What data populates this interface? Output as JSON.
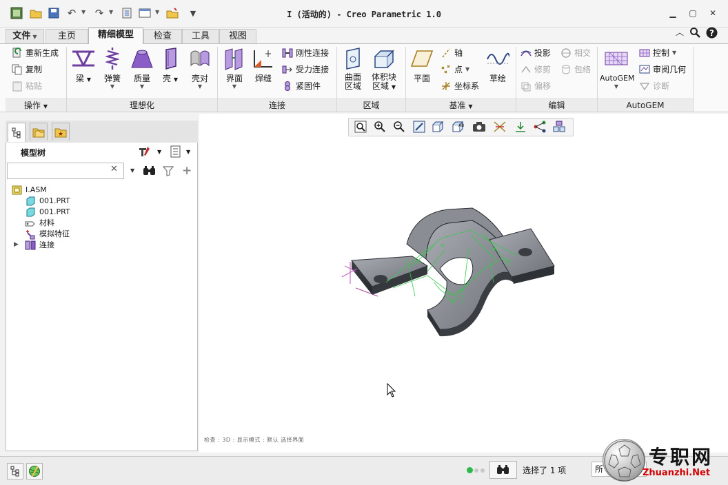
{
  "window": {
    "title": "I (活动的) - Creo Parametric 1.0"
  },
  "tabs": [
    {
      "label": "文件",
      "has_dropdown": true
    },
    {
      "label": "主页"
    },
    {
      "label": "精细模型",
      "active": true
    },
    {
      "label": "检查"
    },
    {
      "label": "工具"
    },
    {
      "label": "视图"
    }
  ],
  "ribbon": {
    "operations": {
      "label": "操作",
      "items": [
        {
          "label": "重新生成",
          "enabled": true
        },
        {
          "label": "复制",
          "enabled": true
        },
        {
          "label": "粘贴",
          "enabled": false
        }
      ]
    },
    "idealization": {
      "label": "理想化",
      "items": [
        {
          "label": "梁"
        },
        {
          "label": "弹簧"
        },
        {
          "label": "质量"
        },
        {
          "label": "壳"
        },
        {
          "label": "壳对"
        }
      ]
    },
    "connections": {
      "label": "连接",
      "big": [
        {
          "label": "界面"
        },
        {
          "label": "焊缝"
        }
      ],
      "small": [
        {
          "label": "刚性连接"
        },
        {
          "label": "受力连接"
        },
        {
          "label": "紧固件"
        }
      ]
    },
    "regions": {
      "label": "区域",
      "items": [
        {
          "label_line1": "曲面",
          "label_line2": "区域"
        },
        {
          "label_line1": "体积块",
          "label_line2": "区域"
        }
      ]
    },
    "datum": {
      "label": "基准",
      "plane": "平面",
      "small": [
        {
          "label": "轴"
        },
        {
          "label": "点"
        },
        {
          "label": "坐标系"
        }
      ],
      "sketch": "草绘"
    },
    "edit": {
      "label": "编辑",
      "items": [
        {
          "label": "投影",
          "enabled": true
        },
        {
          "label": "修剪",
          "enabled": false
        },
        {
          "label": "偏移",
          "enabled": false
        },
        {
          "label": "相交",
          "enabled": false
        },
        {
          "label": "包络",
          "enabled": false
        }
      ]
    },
    "autogem": {
      "label": "AutoGEM",
      "big": "AutoGEM",
      "items": [
        {
          "label": "控制",
          "enabled": true
        },
        {
          "label": "审阅几何",
          "enabled": true
        },
        {
          "label": "诊断",
          "enabled": false
        }
      ]
    }
  },
  "model_tree": {
    "title": "模型树",
    "search_placeholder": "",
    "items": [
      {
        "label": "I.ASM",
        "level": 0,
        "icon": "assembly-icon"
      },
      {
        "label": "001.PRT",
        "level": 1,
        "icon": "part-icon"
      },
      {
        "label": "001.PRT",
        "level": 1,
        "icon": "part-icon"
      },
      {
        "label": "材料",
        "level": 1,
        "icon": "material-icon"
      },
      {
        "label": "模拟特征",
        "level": 1,
        "icon": "simulation-icon"
      },
      {
        "label": "连接",
        "level": 1,
        "icon": "connection-icon",
        "expandable": true
      }
    ]
  },
  "graphics": {
    "status_text": "检查 : 3D : 显示模式 : 默认 选择界面"
  },
  "statusbar": {
    "selection_text": "选择了 1 项",
    "filter_value": "所"
  },
  "watermark": {
    "main": "专职网",
    "sub": "Zhuanzhi.Net"
  },
  "colors": {
    "accent_green": "#2db84a",
    "active_tab": "#fafafa",
    "part_body": "#7a7e84",
    "annotation": "#35c84a",
    "watermark_red": "#d40000"
  }
}
